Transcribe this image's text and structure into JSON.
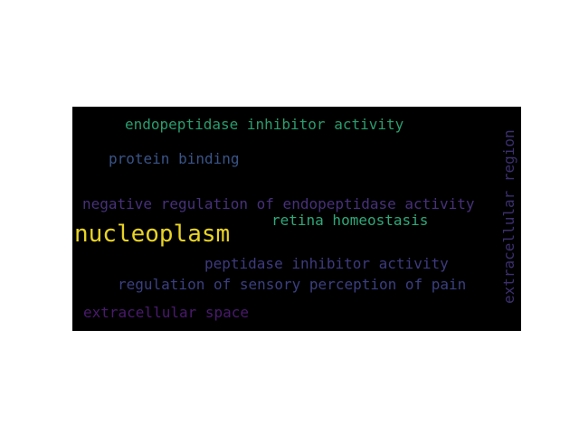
{
  "word_cloud": {
    "background_color": "#000000",
    "words": [
      {
        "text": "endopeptidase inhibitor activity",
        "color": "#2a9d6e"
      },
      {
        "text": "protein binding",
        "color": "#3a5488"
      },
      {
        "text": "negative regulation of endopeptidase activity",
        "color": "#46317a"
      },
      {
        "text": "retina homeostasis",
        "color": "#2ea87a"
      },
      {
        "text": "nucleoplasm",
        "color": "#e8d324"
      },
      {
        "text": "peptidase inhibitor activity",
        "color": "#3d3a7e"
      },
      {
        "text": "regulation of sensory perception of pain",
        "color": "#3b3f80"
      },
      {
        "text": "extracellular space",
        "color": "#4a1a6e"
      },
      {
        "text": "extracellular region",
        "color": "#3c2f6e",
        "orientation": "vertical"
      }
    ]
  }
}
